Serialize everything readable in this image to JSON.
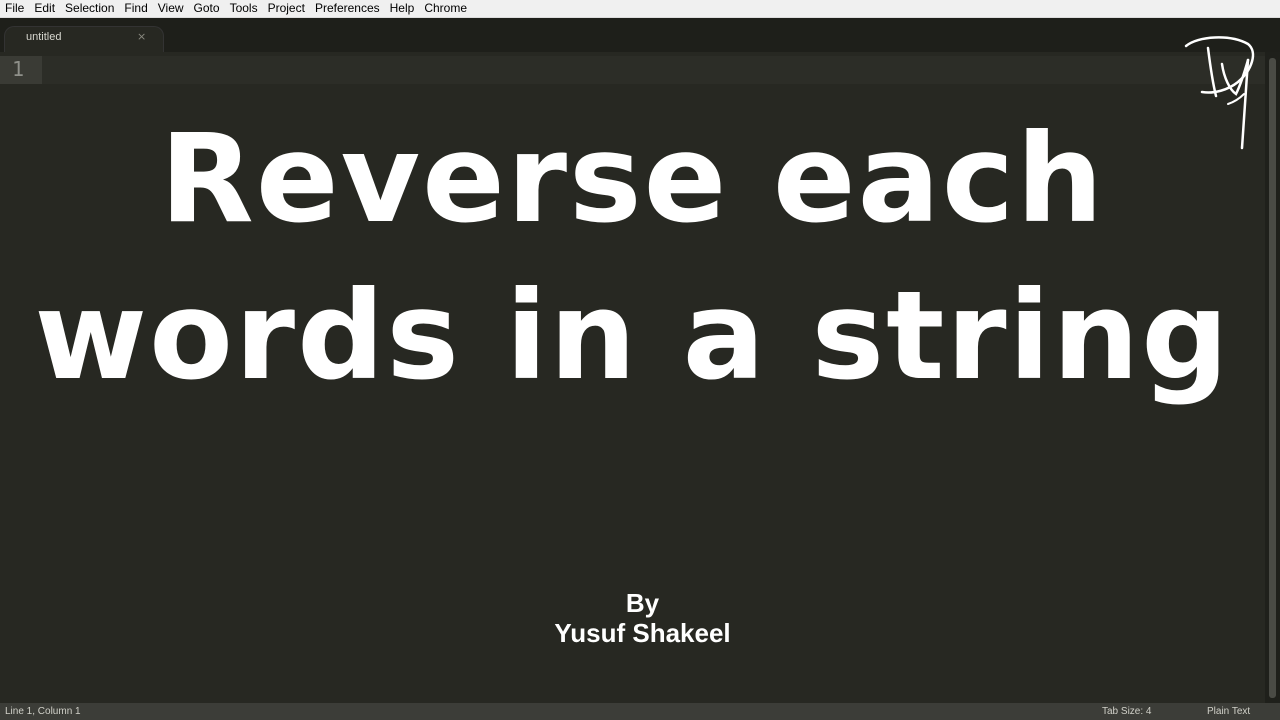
{
  "menubar": {
    "items": [
      "File",
      "Edit",
      "Selection",
      "Find",
      "View",
      "Goto",
      "Tools",
      "Project",
      "Preferences",
      "Help",
      "Chrome"
    ]
  },
  "tabs": [
    {
      "label": "untitled",
      "close": "×"
    }
  ],
  "editor": {
    "line_number": "1",
    "title_line_1": "Reverse each",
    "title_line_2": "words in a string",
    "by": "By",
    "author": "Yusuf Shakeel"
  },
  "logo": {
    "icon": "signature-logo-icon"
  },
  "statusbar": {
    "position": "Line 1, Column 1",
    "tab_size": "Tab Size: 4",
    "syntax": "Plain Text"
  },
  "colors": {
    "editor_bg": "#272822",
    "menubar_bg": "#f0f0f0",
    "statusbar_bg": "#3c3d38",
    "text": "#ffffff"
  }
}
